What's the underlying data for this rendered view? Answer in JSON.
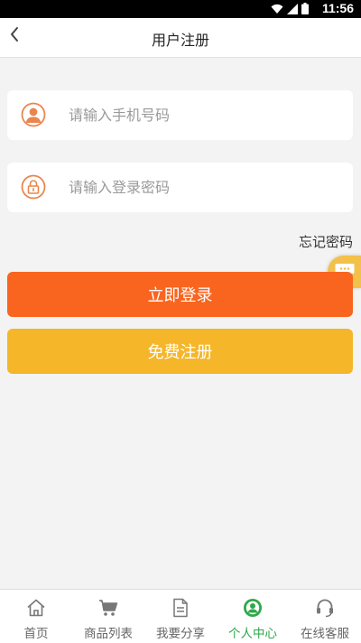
{
  "status_bar": {
    "time": "11:56",
    "wifi_icon": "wifi-icon",
    "signal_icon": "signal-icon",
    "battery_icon": "battery-icon"
  },
  "nav": {
    "title": "用户注册",
    "back_icon": "chevron-left-icon"
  },
  "form": {
    "phone": {
      "placeholder": "请输入手机号码",
      "value": "",
      "icon": "user-icon"
    },
    "password": {
      "placeholder": "请输入登录密码",
      "value": "",
      "icon": "lock-icon"
    },
    "forgot_label": "忘记密码",
    "login_label": "立即登录",
    "register_label": "免费注册"
  },
  "tabs": [
    {
      "label": "首页",
      "icon": "home-icon",
      "active": false
    },
    {
      "label": "商品列表",
      "icon": "cart-icon",
      "active": false
    },
    {
      "label": "我要分享",
      "icon": "document-icon",
      "active": false
    },
    {
      "label": "个人中心",
      "icon": "person-circle-icon",
      "active": true
    },
    {
      "label": "在线客服",
      "icon": "headset-icon",
      "active": false
    }
  ],
  "colors": {
    "login_button": "#f9651f",
    "register_button": "#f5b62a",
    "icon_orange": "#e9864f",
    "active_tab": "#2ea84b",
    "inactive_tab": "#666666",
    "background": "#f3f3f3"
  }
}
